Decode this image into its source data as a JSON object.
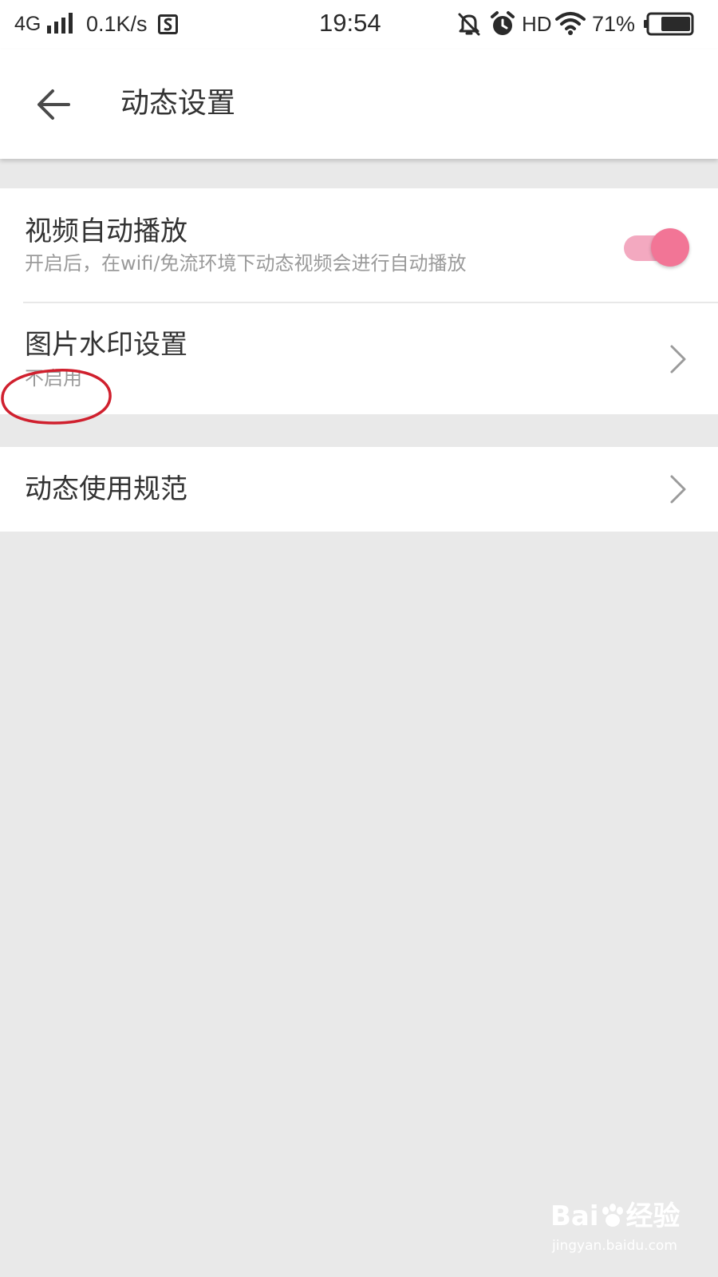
{
  "status_bar": {
    "network": "4G",
    "speed": "0.1K/s",
    "time": "19:54",
    "hd": "HD",
    "battery": "71%",
    "battery_level": 0.71,
    "icons": [
      "signal-icon",
      "s-app-icon",
      "bell-off-icon",
      "alarm-icon",
      "wifi-icon",
      "battery-icon"
    ]
  },
  "header": {
    "back_icon": "back-arrow-icon",
    "title": "动态设置"
  },
  "settings": {
    "video_autoplay": {
      "title": "视频自动播放",
      "subtitle": "开启后，在wifi/免流环境下动态视频会进行自动播放",
      "enabled": true
    },
    "image_watermark": {
      "title": "图片水印设置",
      "value": "不启用",
      "icon": "chevron-right-icon"
    },
    "usage_rules": {
      "title": "动态使用规范",
      "icon": "chevron-right-icon"
    }
  },
  "watermark": {
    "brand": "Bai",
    "brand_suffix": "经验",
    "url": "jingyan.baidu.com"
  },
  "colors": {
    "accent": "#f27596",
    "accent_track": "#f3a9c0",
    "annotation": "#d0202e",
    "background": "#e9e9e9"
  }
}
